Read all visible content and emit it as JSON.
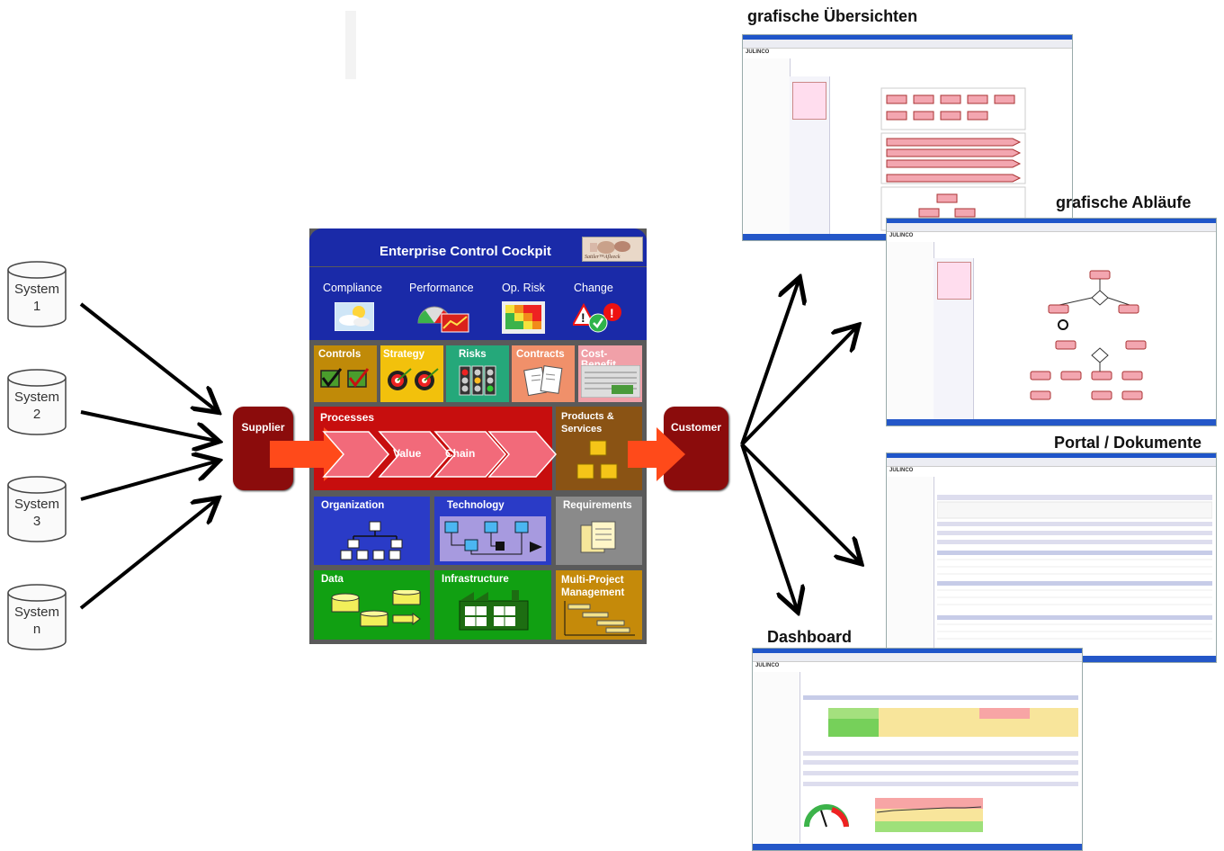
{
  "systems": [
    {
      "line1": "System",
      "line2": "1"
    },
    {
      "line1": "System",
      "line2": "2"
    },
    {
      "line1": "System",
      "line2": "3"
    },
    {
      "line1": "System",
      "line2": "n"
    }
  ],
  "supplier": "Supplier",
  "customer": "Customer",
  "cockpit": {
    "title": "Enterprise Control Cockpit",
    "logo_text": "Sattler™Afleeck",
    "top": [
      "Compliance",
      "Performance",
      "Op. Risk",
      "Change"
    ],
    "row2": [
      "Controls",
      "Strategy",
      "Risks",
      "Contracts",
      "Cost-Benefit"
    ],
    "processes": "Processes",
    "value": "Value",
    "chain": "Chain",
    "products": "Products & Services",
    "row4": [
      "Organization",
      "Technology",
      "Requirements"
    ],
    "row5": [
      "Data",
      "Infrastructure",
      "Multi-Project Management"
    ]
  },
  "screens": {
    "uebersichten": "grafische Übersichten",
    "ablaeufe": "grafische Abläufe",
    "portal": "Portal / Dokumente",
    "dashboard": "Dashboard",
    "brand": "JULINCO"
  },
  "colors": {
    "dark_red": "#8b0c0c",
    "cockpit_blue": "#1a2aa8",
    "arrow_orange": "#ff4a1a"
  }
}
